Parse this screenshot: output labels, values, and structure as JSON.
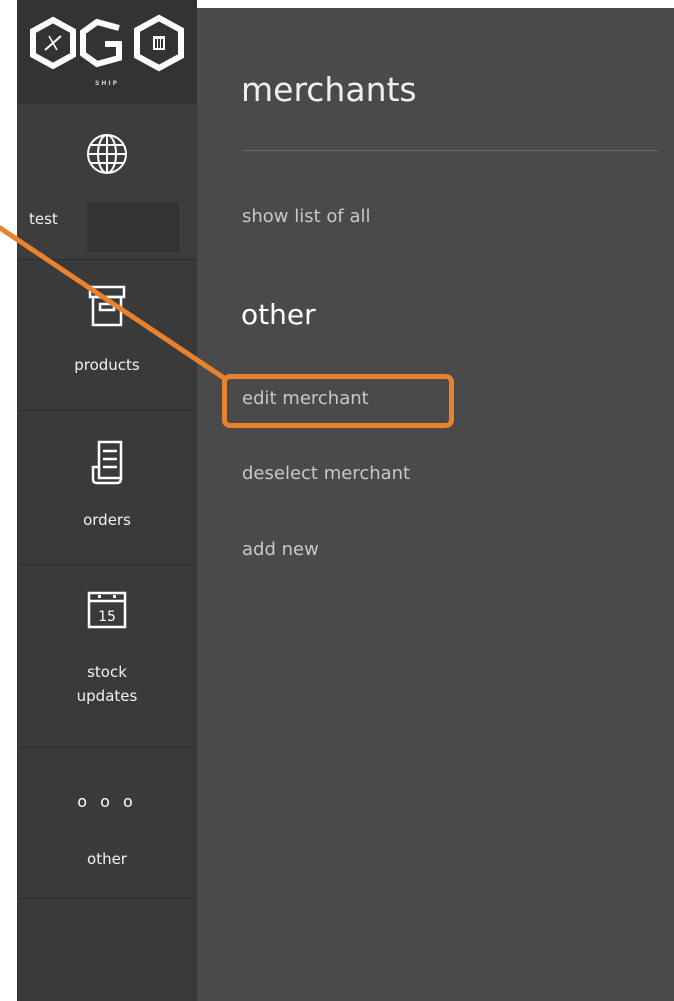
{
  "colors": {
    "accent": "#e8822e",
    "sidebar_bg": "#3a3a3a",
    "panel_bg": "#4a4a4a"
  },
  "logo": {
    "name": "OGO",
    "subtitle": "SHIP"
  },
  "sidebar": {
    "items": [
      {
        "label": "test",
        "icon": "globe-icon"
      },
      {
        "label": "products",
        "icon": "box-icon"
      },
      {
        "label": "orders",
        "icon": "receipt-icon"
      },
      {
        "label": "stock updates",
        "label_line1": "stock",
        "label_line2": "updates",
        "icon": "calendar-icon",
        "icon_text": "15"
      },
      {
        "label": "other",
        "icon": "dots-icon",
        "icon_text": "o o o"
      }
    ]
  },
  "main": {
    "title": "merchants",
    "links": [
      {
        "label": "show list of all"
      }
    ],
    "section": {
      "heading": "other",
      "links": [
        {
          "label": "edit merchant"
        },
        {
          "label": "deselect merchant"
        },
        {
          "label": "add new"
        }
      ]
    }
  }
}
